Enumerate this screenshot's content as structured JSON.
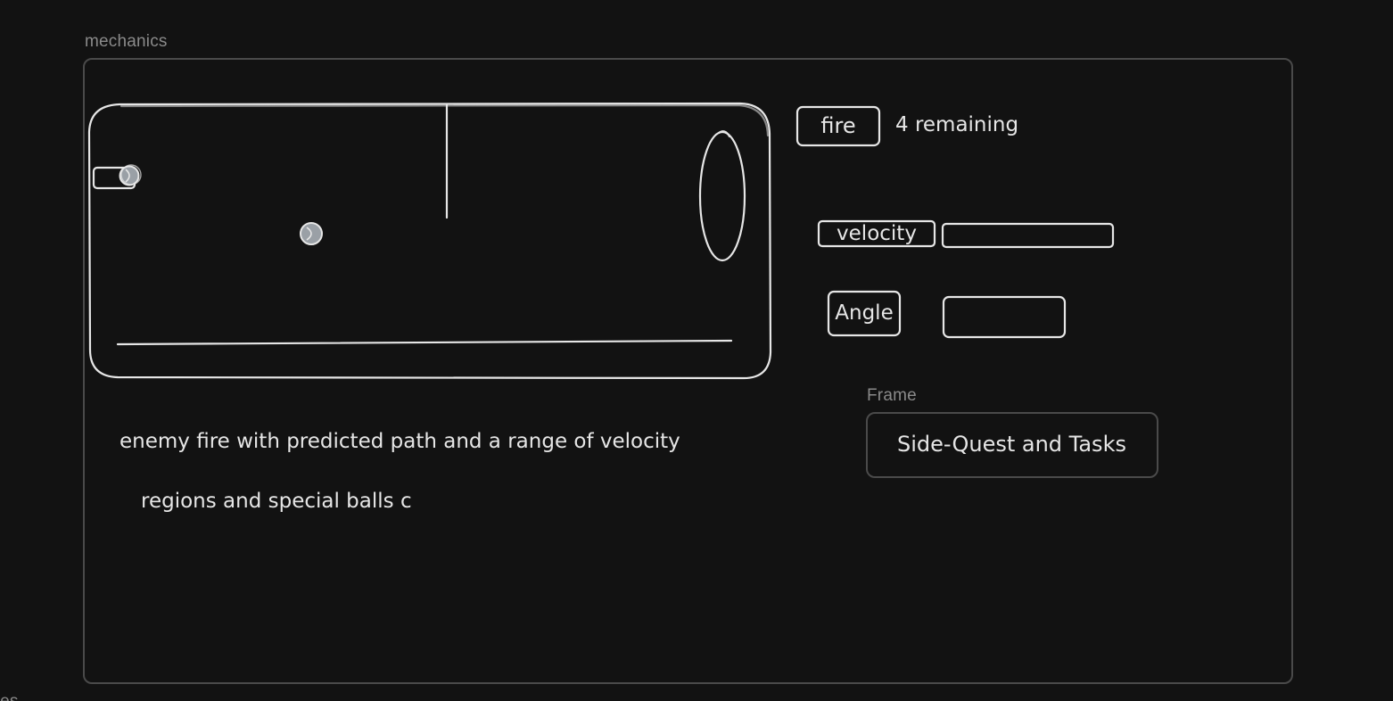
{
  "frames": {
    "mechanics": {
      "label": "mechanics"
    },
    "inner": {
      "label": "Frame"
    },
    "bottom_cut": {
      "label": "ices"
    }
  },
  "controls": {
    "fire_label": "fire",
    "remaining_text": "4 remaining",
    "velocity_label": "velocity",
    "velocity_value": "",
    "angle_label": "Angle",
    "angle_value": ""
  },
  "notes": {
    "line1": "enemy fire with predicted path and a range of velocity",
    "line2": "regions and special balls c"
  },
  "side_quest": {
    "label": "Side-Quest and Tasks"
  },
  "colors": {
    "background": "#121212",
    "stroke": "#e6e6e6",
    "frame_border": "#4a4a4a",
    "frame_label": "#8a8a8a",
    "ball_fill": "#9aa0a6"
  }
}
